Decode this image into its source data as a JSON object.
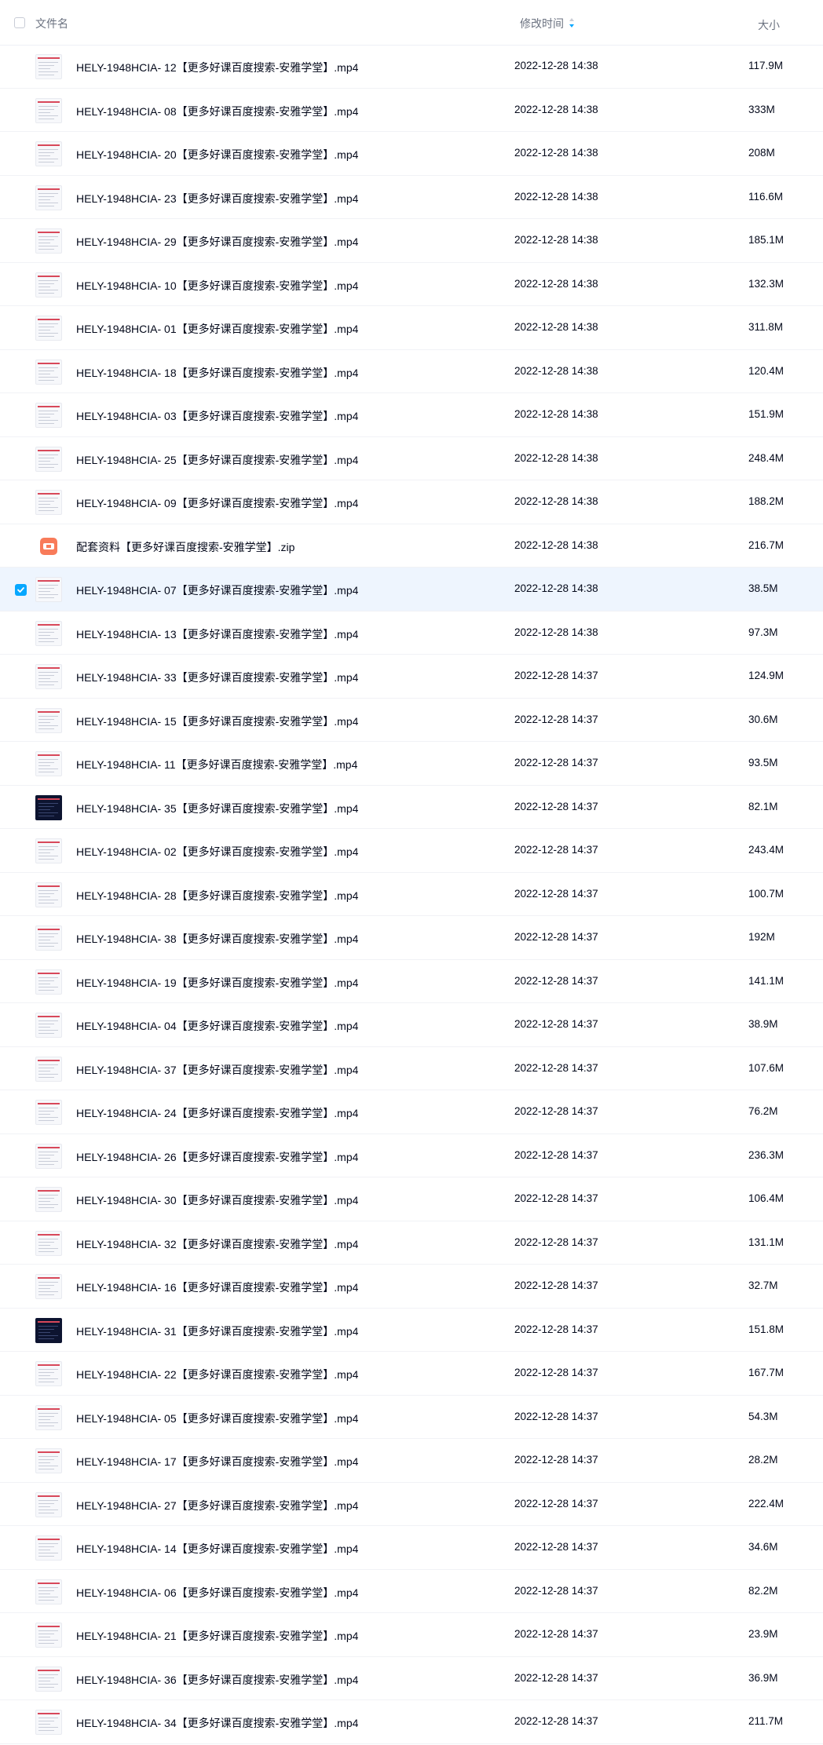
{
  "header": {
    "name_label": "文件名",
    "mtime_label": "修改时间",
    "size_label": "大小",
    "sort_icon": "sort-desc-icon",
    "accent_color": "#06a7ff"
  },
  "files": [
    {
      "name": "HELY-1948HCIA- 12【更多好课百度搜索-安雅学堂】.mp4",
      "mtime": "2022-12-28 14:38",
      "size": "117.9M",
      "icon": "video-thumbnail",
      "selected": false
    },
    {
      "name": "HELY-1948HCIA- 08【更多好课百度搜索-安雅学堂】.mp4",
      "mtime": "2022-12-28 14:38",
      "size": "333M",
      "icon": "video-thumbnail",
      "selected": false
    },
    {
      "name": "HELY-1948HCIA- 20【更多好课百度搜索-安雅学堂】.mp4",
      "mtime": "2022-12-28 14:38",
      "size": "208M",
      "icon": "video-thumbnail",
      "selected": false
    },
    {
      "name": "HELY-1948HCIA- 23【更多好课百度搜索-安雅学堂】.mp4",
      "mtime": "2022-12-28 14:38",
      "size": "116.6M",
      "icon": "video-thumbnail",
      "selected": false
    },
    {
      "name": "HELY-1948HCIA- 29【更多好课百度搜索-安雅学堂】.mp4",
      "mtime": "2022-12-28 14:38",
      "size": "185.1M",
      "icon": "video-thumbnail",
      "selected": false
    },
    {
      "name": "HELY-1948HCIA- 10【更多好课百度搜索-安雅学堂】.mp4",
      "mtime": "2022-12-28 14:38",
      "size": "132.3M",
      "icon": "video-thumbnail",
      "selected": false
    },
    {
      "name": "HELY-1948HCIA- 01【更多好课百度搜索-安雅学堂】.mp4",
      "mtime": "2022-12-28 14:38",
      "size": "311.8M",
      "icon": "video-thumbnail",
      "selected": false
    },
    {
      "name": "HELY-1948HCIA- 18【更多好课百度搜索-安雅学堂】.mp4",
      "mtime": "2022-12-28 14:38",
      "size": "120.4M",
      "icon": "video-thumbnail",
      "selected": false
    },
    {
      "name": "HELY-1948HCIA- 03【更多好课百度搜索-安雅学堂】.mp4",
      "mtime": "2022-12-28 14:38",
      "size": "151.9M",
      "icon": "video-thumbnail",
      "selected": false
    },
    {
      "name": "HELY-1948HCIA- 25【更多好课百度搜索-安雅学堂】.mp4",
      "mtime": "2022-12-28 14:38",
      "size": "248.4M",
      "icon": "video-thumbnail",
      "selected": false
    },
    {
      "name": "HELY-1948HCIA- 09【更多好课百度搜索-安雅学堂】.mp4",
      "mtime": "2022-12-28 14:38",
      "size": "188.2M",
      "icon": "video-thumbnail",
      "selected": false
    },
    {
      "name": "配套资料【更多好课百度搜索-安雅学堂】.zip",
      "mtime": "2022-12-28 14:38",
      "size": "216.7M",
      "icon": "zip-icon",
      "selected": false
    },
    {
      "name": "HELY-1948HCIA- 07【更多好课百度搜索-安雅学堂】.mp4",
      "mtime": "2022-12-28 14:38",
      "size": "38.5M",
      "icon": "video-thumbnail",
      "selected": true
    },
    {
      "name": "HELY-1948HCIA- 13【更多好课百度搜索-安雅学堂】.mp4",
      "mtime": "2022-12-28 14:38",
      "size": "97.3M",
      "icon": "video-thumbnail",
      "selected": false
    },
    {
      "name": "HELY-1948HCIA- 33【更多好课百度搜索-安雅学堂】.mp4",
      "mtime": "2022-12-28 14:37",
      "size": "124.9M",
      "icon": "video-thumbnail",
      "selected": false
    },
    {
      "name": "HELY-1948HCIA- 15【更多好课百度搜索-安雅学堂】.mp4",
      "mtime": "2022-12-28 14:37",
      "size": "30.6M",
      "icon": "video-thumbnail",
      "selected": false
    },
    {
      "name": "HELY-1948HCIA- 11【更多好课百度搜索-安雅学堂】.mp4",
      "mtime": "2022-12-28 14:37",
      "size": "93.5M",
      "icon": "video-thumbnail",
      "selected": false
    },
    {
      "name": "HELY-1948HCIA- 35【更多好课百度搜索-安雅学堂】.mp4",
      "mtime": "2022-12-28 14:37",
      "size": "82.1M",
      "icon": "video-thumbnail-dark",
      "selected": false
    },
    {
      "name": "HELY-1948HCIA- 02【更多好课百度搜索-安雅学堂】.mp4",
      "mtime": "2022-12-28 14:37",
      "size": "243.4M",
      "icon": "video-thumbnail",
      "selected": false
    },
    {
      "name": "HELY-1948HCIA- 28【更多好课百度搜索-安雅学堂】.mp4",
      "mtime": "2022-12-28 14:37",
      "size": "100.7M",
      "icon": "video-thumbnail",
      "selected": false
    },
    {
      "name": "HELY-1948HCIA- 38【更多好课百度搜索-安雅学堂】.mp4",
      "mtime": "2022-12-28 14:37",
      "size": "192M",
      "icon": "video-thumbnail",
      "selected": false
    },
    {
      "name": "HELY-1948HCIA- 19【更多好课百度搜索-安雅学堂】.mp4",
      "mtime": "2022-12-28 14:37",
      "size": "141.1M",
      "icon": "video-thumbnail",
      "selected": false
    },
    {
      "name": "HELY-1948HCIA- 04【更多好课百度搜索-安雅学堂】.mp4",
      "mtime": "2022-12-28 14:37",
      "size": "38.9M",
      "icon": "video-thumbnail",
      "selected": false
    },
    {
      "name": "HELY-1948HCIA- 37【更多好课百度搜索-安雅学堂】.mp4",
      "mtime": "2022-12-28 14:37",
      "size": "107.6M",
      "icon": "video-thumbnail",
      "selected": false
    },
    {
      "name": "HELY-1948HCIA- 24【更多好课百度搜索-安雅学堂】.mp4",
      "mtime": "2022-12-28 14:37",
      "size": "76.2M",
      "icon": "video-thumbnail",
      "selected": false
    },
    {
      "name": "HELY-1948HCIA- 26【更多好课百度搜索-安雅学堂】.mp4",
      "mtime": "2022-12-28 14:37",
      "size": "236.3M",
      "icon": "video-thumbnail",
      "selected": false
    },
    {
      "name": "HELY-1948HCIA- 30【更多好课百度搜索-安雅学堂】.mp4",
      "mtime": "2022-12-28 14:37",
      "size": "106.4M",
      "icon": "video-thumbnail",
      "selected": false
    },
    {
      "name": "HELY-1948HCIA- 32【更多好课百度搜索-安雅学堂】.mp4",
      "mtime": "2022-12-28 14:37",
      "size": "131.1M",
      "icon": "video-thumbnail",
      "selected": false
    },
    {
      "name": "HELY-1948HCIA- 16【更多好课百度搜索-安雅学堂】.mp4",
      "mtime": "2022-12-28 14:37",
      "size": "32.7M",
      "icon": "video-thumbnail",
      "selected": false
    },
    {
      "name": "HELY-1948HCIA- 31【更多好课百度搜索-安雅学堂】.mp4",
      "mtime": "2022-12-28 14:37",
      "size": "151.8M",
      "icon": "video-thumbnail-dark",
      "selected": false
    },
    {
      "name": "HELY-1948HCIA- 22【更多好课百度搜索-安雅学堂】.mp4",
      "mtime": "2022-12-28 14:37",
      "size": "167.7M",
      "icon": "video-thumbnail",
      "selected": false
    },
    {
      "name": "HELY-1948HCIA- 05【更多好课百度搜索-安雅学堂】.mp4",
      "mtime": "2022-12-28 14:37",
      "size": "54.3M",
      "icon": "video-thumbnail",
      "selected": false
    },
    {
      "name": "HELY-1948HCIA- 17【更多好课百度搜索-安雅学堂】.mp4",
      "mtime": "2022-12-28 14:37",
      "size": "28.2M",
      "icon": "video-thumbnail",
      "selected": false
    },
    {
      "name": "HELY-1948HCIA- 27【更多好课百度搜索-安雅学堂】.mp4",
      "mtime": "2022-12-28 14:37",
      "size": "222.4M",
      "icon": "video-thumbnail",
      "selected": false
    },
    {
      "name": "HELY-1948HCIA- 14【更多好课百度搜索-安雅学堂】.mp4",
      "mtime": "2022-12-28 14:37",
      "size": "34.6M",
      "icon": "video-thumbnail",
      "selected": false
    },
    {
      "name": "HELY-1948HCIA- 06【更多好课百度搜索-安雅学堂】.mp4",
      "mtime": "2022-12-28 14:37",
      "size": "82.2M",
      "icon": "video-thumbnail",
      "selected": false
    },
    {
      "name": "HELY-1948HCIA- 21【更多好课百度搜索-安雅学堂】.mp4",
      "mtime": "2022-12-28 14:37",
      "size": "23.9M",
      "icon": "video-thumbnail",
      "selected": false
    },
    {
      "name": "HELY-1948HCIA- 36【更多好课百度搜索-安雅学堂】.mp4",
      "mtime": "2022-12-28 14:37",
      "size": "36.9M",
      "icon": "video-thumbnail",
      "selected": false
    },
    {
      "name": "HELY-1948HCIA- 34【更多好课百度搜索-安雅学堂】.mp4",
      "mtime": "2022-12-28 14:37",
      "size": "211.7M",
      "icon": "video-thumbnail",
      "selected": false
    }
  ]
}
